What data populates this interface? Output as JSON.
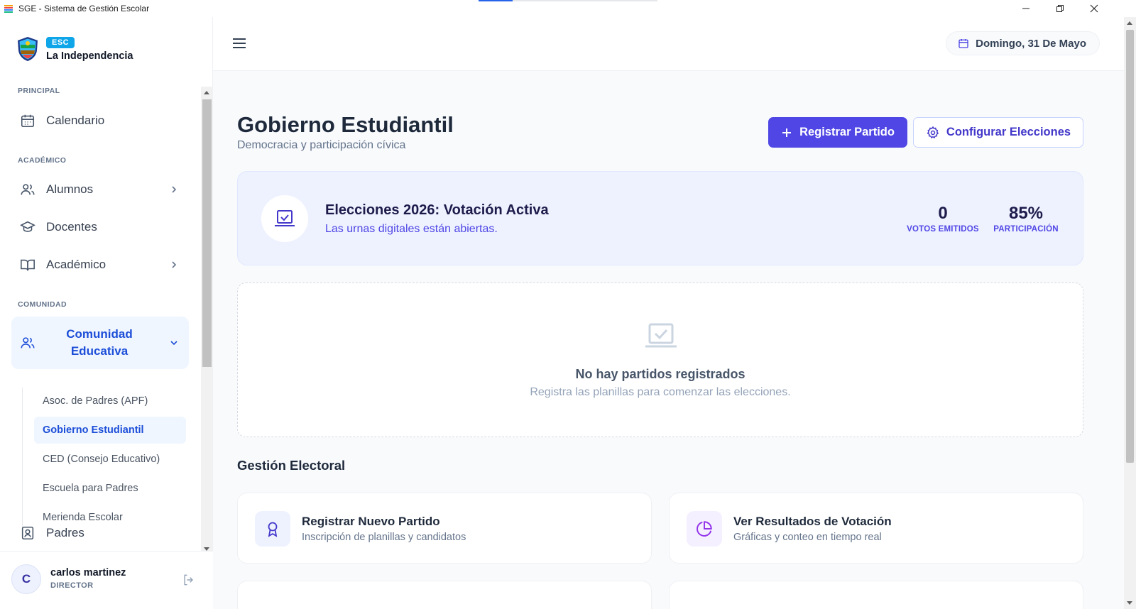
{
  "window": {
    "title": "SGE - Sistema de Gestión Escolar",
    "loading_progress": 0.19
  },
  "brand": {
    "badge": "ESC",
    "school_name": "La Independencia"
  },
  "sidebar": {
    "sections": {
      "principal": "PRINCIPAL",
      "academico": "ACADÉMICO",
      "comunidad": "COMUNIDAD"
    },
    "items": {
      "calendario": "Calendario",
      "alumnos": "Alumnos",
      "docentes": "Docentes",
      "academico": "Académico",
      "comunidad": "Comunidad Educativa",
      "padres": "Padres"
    },
    "comunidad_sub": [
      "Asoc. de Padres (APF)",
      "Gobierno Estudiantil",
      "CED (Consejo Educativo)",
      "Escuela para Padres",
      "Merienda Escolar"
    ],
    "active_sub": "Gobierno Estudiantil"
  },
  "user": {
    "initial": "C",
    "name": "carlos martinez",
    "role": "DIRECTOR"
  },
  "topbar": {
    "date": "Domingo, 31 De Mayo"
  },
  "page": {
    "title": "Gobierno Estudiantil",
    "subtitle": "Democracia y participación cívica",
    "btn_register": "Registrar Partido",
    "btn_config": "Configurar Elecciones"
  },
  "election": {
    "title": "Elecciones 2026: Votación Activa",
    "subtitle": "Las urnas digitales están abiertas.",
    "votes_value": "0",
    "votes_label": "VOTOS EMITIDOS",
    "participation_value": "85%",
    "participation_label": "PARTICIPACIÓN"
  },
  "empty": {
    "title": "No hay partidos registrados",
    "subtitle": "Registra las planillas para comenzar las elecciones."
  },
  "management": {
    "title": "Gestión Electoral",
    "cards": [
      {
        "title": "Registrar Nuevo Partido",
        "subtitle": "Inscripción de planillas y candidatos",
        "icon": "award-icon"
      },
      {
        "title": "Ver Resultados de Votación",
        "subtitle": "Gráficas y conteo en tiempo real",
        "icon": "pie-chart-icon"
      }
    ]
  },
  "colors": {
    "primary": "#4f46e5",
    "sidebar_active": "#1d4ed8",
    "badge": "#0ea5e9"
  }
}
